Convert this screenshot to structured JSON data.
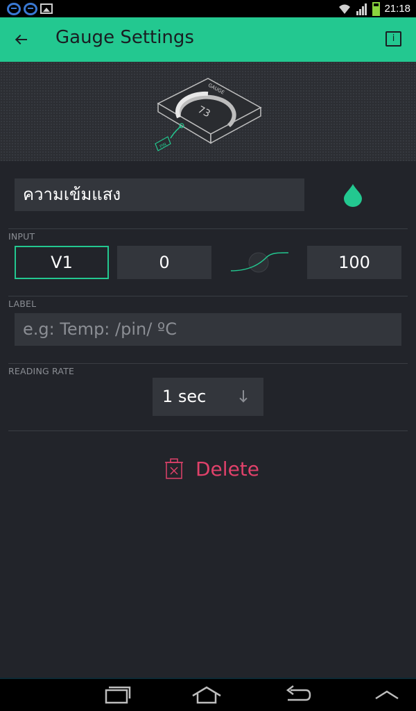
{
  "status_bar": {
    "time": "21:18",
    "icons": [
      "s-icon",
      "s-icon",
      "image-icon",
      "wifi-icon",
      "signal-icon",
      "battery-icon"
    ],
    "battery_color": "#8ad43e"
  },
  "app_bar": {
    "title": "Gauge Settings",
    "back_icon": "arrow-left-icon",
    "info_icon": "info-icon",
    "background": "#23c890"
  },
  "preview": {
    "gauge_label": "GAUGE",
    "gauge_value": "73",
    "pin_label": "PIN"
  },
  "widget": {
    "name": "ความเข้มแสง",
    "color_icon": "water-drop-icon",
    "color": "#23c890"
  },
  "input": {
    "section_label": "INPUT",
    "pin": "V1",
    "min": "0",
    "max": "100",
    "curve_icon": "mapping-curve-icon"
  },
  "label": {
    "section_label": "LABEL",
    "placeholder": "e.g: Temp: /pin/ ºC",
    "value": ""
  },
  "reading_rate": {
    "section_label": "READING RATE",
    "value": "1 sec",
    "arrow_icon": "arrow-down-icon"
  },
  "delete": {
    "label": "Delete",
    "icon": "trash-icon",
    "color": "#e0416a"
  },
  "nav_bar": {
    "buttons": [
      "recent-apps-icon",
      "home-icon",
      "back-icon",
      "menu-up-icon"
    ]
  }
}
